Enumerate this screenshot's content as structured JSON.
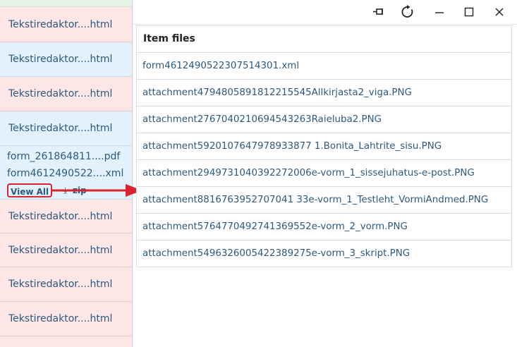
{
  "left_list": {
    "rows": [
      {
        "label": "Tekstiredaktor....html",
        "tone": "pink"
      },
      {
        "label": "Tekstiredaktor....html",
        "tone": "blue"
      },
      {
        "label": "Tekstiredaktor....html",
        "tone": "pink"
      },
      {
        "label": "Tekstiredaktor....html",
        "tone": "blue"
      }
    ],
    "attachment_row": {
      "files": [
        "form_261864811....pdf",
        "form4612490522....xml"
      ],
      "view_all_label": "View All",
      "zip_label": "zip"
    },
    "rows_after": [
      {
        "label": "Tekstiredaktor....html",
        "tone": "pink"
      },
      {
        "label": "Tekstiredaktor....html",
        "tone": "pink"
      },
      {
        "label": "Tekstiredaktor....html",
        "tone": "pink"
      },
      {
        "label": "Tekstiredaktor....html",
        "tone": "pink"
      }
    ]
  },
  "window_controls": {
    "icons": [
      "pin-icon",
      "refresh-icon",
      "minimize-icon",
      "maximize-icon",
      "close-icon"
    ]
  },
  "item_files": {
    "header": "Item files",
    "items": [
      "form4612490522307514301.xml",
      "attachment4794805891812215545Allkirjasta2_viga.PNG",
      "attachment2767040210694543263Raieluba2.PNG",
      "attachment5920107647978933877 1.Bonita_Lahtrite_sisu.PNG",
      "attachment2949731040392272006e-vorm_1_sissejuhatus-e-post.PNG",
      "attachment8816763952707041 33e-vorm_1_Testleht_VormiAndmed.PNG",
      "attachment5764770492741369552e-vorm_2_vorm.PNG",
      "attachment5496326005422389275e-vorm_3_skript.PNG"
    ]
  },
  "colors": {
    "link": "#2b5a80",
    "pink_row": "#fde6e6",
    "blue_row": "#e3f1fc",
    "highlight": "#d9232e"
  }
}
